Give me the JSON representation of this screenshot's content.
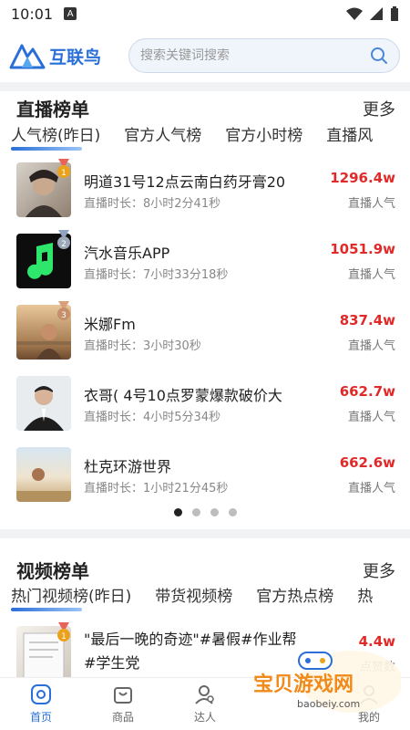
{
  "status": {
    "time": "10:01"
  },
  "header": {
    "logo_text": "互联鸟",
    "search_placeholder": "搜索关键词搜索"
  },
  "live": {
    "title": "直播榜单",
    "more": "更多",
    "tabs": [
      {
        "label": "人气榜(昨日)",
        "active": true
      },
      {
        "label": "官方人气榜",
        "active": false
      },
      {
        "label": "官方小时榜",
        "active": false
      },
      {
        "label": "直播风",
        "active": false
      }
    ],
    "items": [
      {
        "rank": "1",
        "name": "明道31号12点云南白药牙膏20",
        "duration": "直播时长：8小时2分41秒",
        "value": "1296.4w",
        "value_label": "直播人气"
      },
      {
        "rank": "2",
        "name": "汽水音乐APP",
        "duration": "直播时长：7小时33分18秒",
        "value": "1051.9w",
        "value_label": "直播人气"
      },
      {
        "rank": "3",
        "name": "米娜Fm",
        "duration": "直播时长：3小时30秒",
        "value": "837.4w",
        "value_label": "直播人气"
      },
      {
        "rank": "",
        "name": "衣哥( 4号10点罗蒙爆款破价大",
        "duration": "直播时长：4小时5分34秒",
        "value": "662.7w",
        "value_label": "直播人气"
      },
      {
        "rank": "",
        "name": "杜克环游世界",
        "duration": "直播时长：1小时21分45秒",
        "value": "662.6w",
        "value_label": "直播人气"
      }
    ],
    "carousel_pages": 4,
    "carousel_active": 0
  },
  "video": {
    "title": "视频榜单",
    "more": "更多",
    "tabs": [
      {
        "label": "热门视频榜(昨日)",
        "active": true
      },
      {
        "label": "带货视频榜",
        "active": false
      },
      {
        "label": "官方热点榜",
        "active": false
      },
      {
        "label": "热",
        "active": false
      }
    ],
    "items": [
      {
        "rank": "1",
        "name": "\"最后一晚的奇迹\"#暑假#作业帮#学生党",
        "value": "4.4w",
        "value_label": "点赞数"
      }
    ]
  },
  "bottom_nav": [
    {
      "label": "首页",
      "icon": "home-icon",
      "active": true
    },
    {
      "label": "商品",
      "icon": "bag-icon",
      "active": false
    },
    {
      "label": "达人",
      "icon": "person-icon",
      "active": false
    },
    {
      "label": "",
      "icon": "",
      "active": false
    },
    {
      "label": "我的",
      "icon": "user-icon",
      "active": false
    }
  ],
  "watermark": {
    "text": "宝贝游戏网",
    "url": "baobeiy.com"
  },
  "colors": {
    "accent": "#2a6fd8",
    "value_red": "#e02a2a",
    "gold": "#e9a21a",
    "silver": "#9aa8b8",
    "bronze": "#c58f6b"
  }
}
